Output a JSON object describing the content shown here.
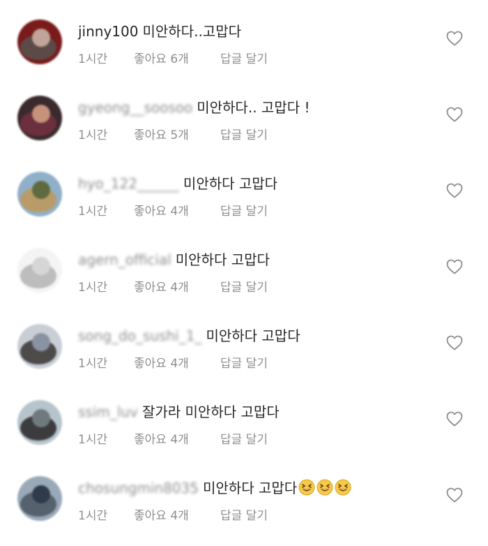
{
  "comments": [
    {
      "username": "jinny100",
      "username_blurred": false,
      "text": "미안하다..고맙다",
      "emojis": [],
      "time": "1시간",
      "likes": "좋아요 6개",
      "reply_label": "답글 달기",
      "avatar_colors": [
        "#7a1a1a",
        "#c2a59a",
        "#5c4a48"
      ]
    },
    {
      "username": "gyeong__soosoo",
      "username_blurred": true,
      "text": "미안하다.. 고맙다 !",
      "emojis": [],
      "time": "1시간",
      "likes": "좋아요 5개",
      "reply_label": "답글 달기",
      "avatar_colors": [
        "#3a2a2e",
        "#c7927a",
        "#6b2f3e"
      ]
    },
    {
      "username": "hyo_122______",
      "username_blurred": true,
      "text": "미안하다 고맙다",
      "emojis": [],
      "time": "1시간",
      "likes": "좋아요 4개",
      "reply_label": "답글 달기",
      "avatar_colors": [
        "#8fb0c8",
        "#5f6b3e",
        "#b99b6a"
      ]
    },
    {
      "username": "agern_official",
      "username_blurred": true,
      "text": "미안하다 고맙다",
      "emojis": [],
      "time": "1시간",
      "likes": "좋아요 4개",
      "reply_label": "답글 달기",
      "avatar_colors": [
        "#f4f4f4",
        "#d6d6d6",
        "#bdbdbd"
      ]
    },
    {
      "username": "song_do_sushi_1_",
      "username_blurred": true,
      "text": "미안하다 고맙다",
      "emojis": [],
      "time": "1시간",
      "likes": "좋아요 4개",
      "reply_label": "답글 달기",
      "avatar_colors": [
        "#c9ced6",
        "#8a93a3",
        "#4d4a4a"
      ]
    },
    {
      "username": "ssim_luv",
      "username_blurred": true,
      "text": "잘가라 미안하다 고맙다",
      "emojis": [],
      "time": "1시간",
      "likes": "좋아요 4개",
      "reply_label": "답글 달기",
      "avatar_colors": [
        "#b8c4cc",
        "#6f7a7f",
        "#3c3c3e"
      ]
    },
    {
      "username": "chosungmin8035",
      "username_blurred": true,
      "text": "미안하다 고맙다",
      "emojis": [
        "grinning-squinting-face",
        "grinning-squinting-face",
        "grinning-squinting-face"
      ],
      "time": "1시간",
      "likes": "좋아요 4개",
      "reply_label": "답글 달기",
      "avatar_colors": [
        "#9aa9b8",
        "#2f3a4a",
        "#55626e"
      ]
    }
  ],
  "heart_icon": "heart-outline-icon",
  "colors": {
    "text_primary": "#262626",
    "text_secondary": "#8e8e8e",
    "heart_stroke": "#8e8e8e",
    "emoji_face": "#f7c948"
  }
}
